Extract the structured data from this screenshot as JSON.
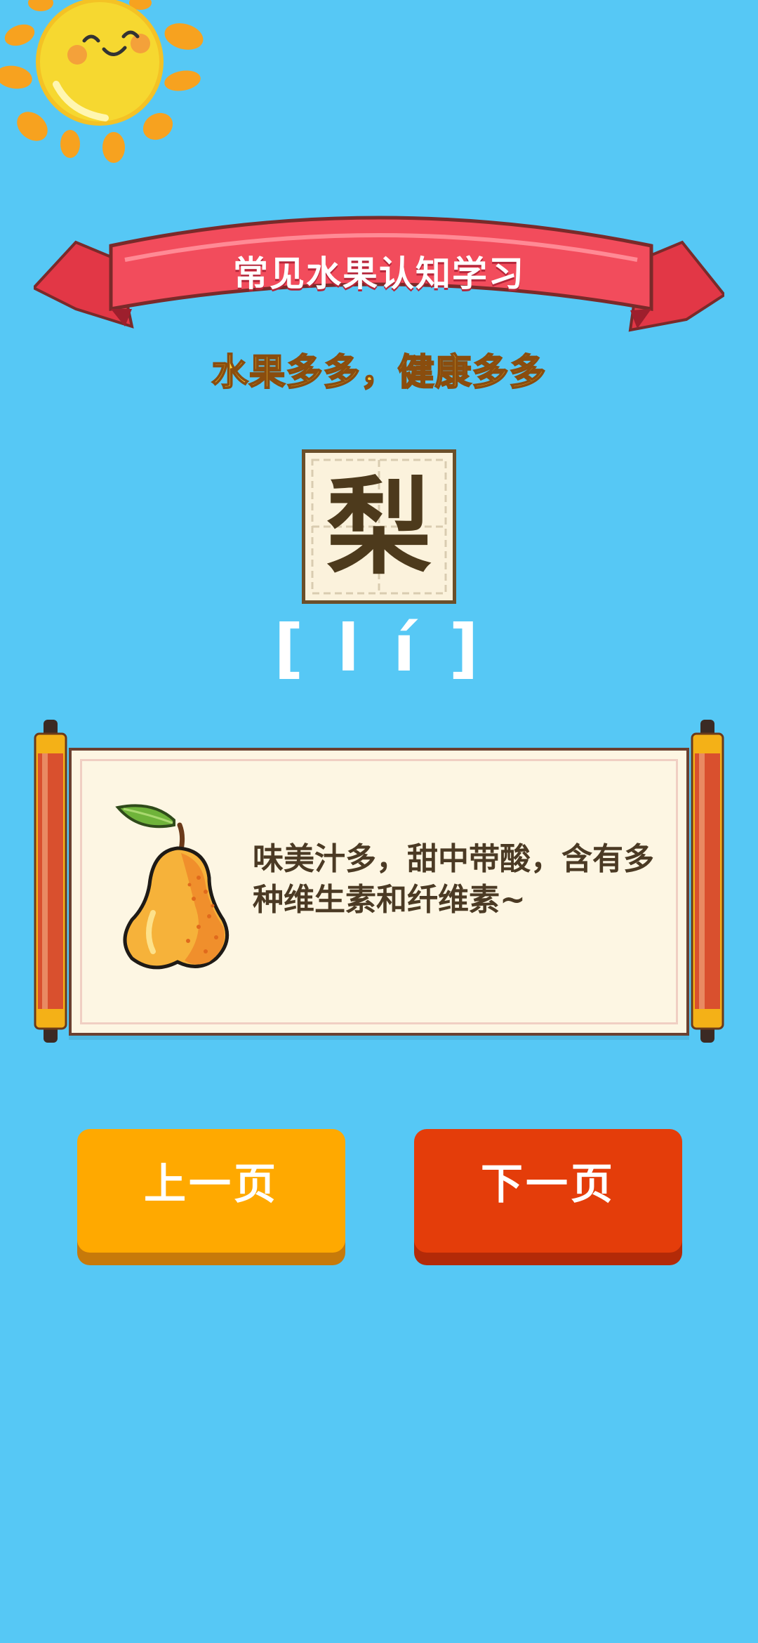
{
  "page": {
    "title": "常见水果认知学习",
    "slogan": "水果多多，健康多多"
  },
  "card": {
    "character": "梨",
    "pinyin": "[ l í ]",
    "description": "味美汁多，甜中带酸，含有多种维生素和纤维素~",
    "image_icon": "pear-icon"
  },
  "buttons": {
    "prev_label": "上一页",
    "next_label": "下一页"
  },
  "colors": {
    "background": "#56c8f5",
    "banner": "#ee4554",
    "prev_button": "#ffa900",
    "next_button": "#e43d0a"
  }
}
